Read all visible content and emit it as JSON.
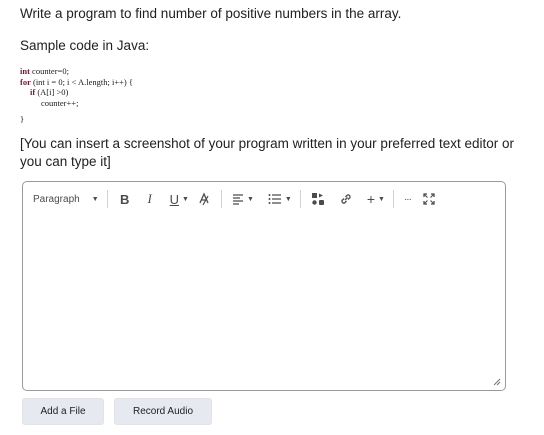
{
  "question": {
    "prompt": "Write a program to find number of positive numbers in the array.",
    "sample_label": "Sample code in Java:",
    "code_lines": [
      {
        "kw": "int",
        "rest": " counter=0;"
      },
      {
        "kw": "for",
        "rest": " (int i = 0; i < A.length; i++) {"
      },
      {
        "kw": "if",
        "rest": " (A[i] >0)"
      },
      {
        "kw": "",
        "rest": "counter++;"
      },
      {
        "kw": "",
        "rest": "}"
      }
    ],
    "instructions_line1": "[You can insert a screenshot of your program written in your preferred text editor or",
    "instructions_line2": "you can type it]"
  },
  "toolbar": {
    "format_select": "Paragraph",
    "bold": "B",
    "italic": "I",
    "underline": "U",
    "insert": "+",
    "more": "···"
  },
  "editor": {
    "content": ""
  },
  "buttons": {
    "add_file": "Add a File",
    "record_audio": "Record Audio"
  },
  "colors": {
    "button_bg": "#e6eaf0",
    "editor_border": "#9a9a9a",
    "code_keyword": "#7a1630"
  }
}
